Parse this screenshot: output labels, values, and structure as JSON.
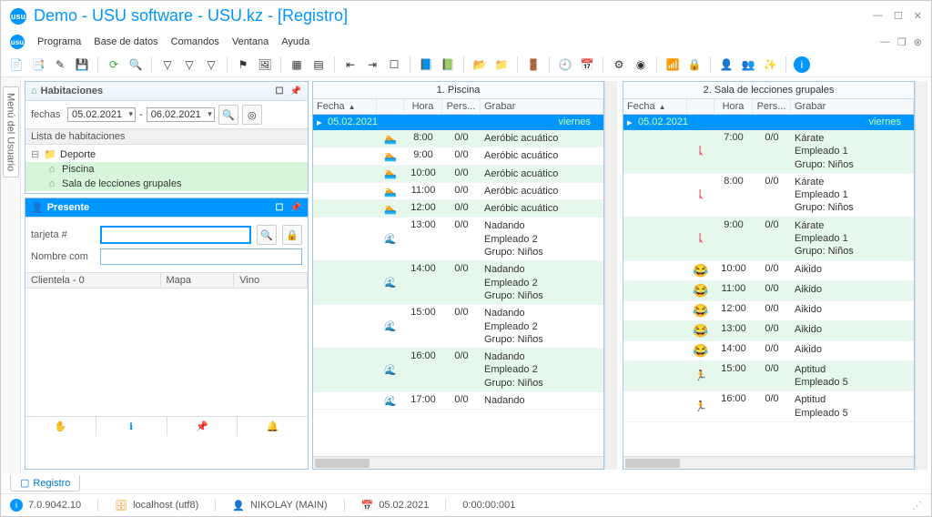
{
  "window": {
    "title": "Demo - USU software - USU.kz - [Registro]"
  },
  "menu": {
    "items": [
      "Programa",
      "Base de datos",
      "Comandos",
      "Ventana",
      "Ayuda"
    ]
  },
  "sidebar_tab": "Menú del Usuario",
  "rooms_panel": {
    "title": "Habitaciones",
    "date_label": "fechas",
    "date_from": "05.02.2021",
    "date_to": "06.02.2021",
    "list_header": "Lista de habitaciones",
    "tree": {
      "root": "Deporte",
      "children": [
        "Piscina",
        "Sala de lecciones grupales"
      ]
    }
  },
  "present_panel": {
    "title": "Presente",
    "card_label": "tarjeta #",
    "name_label": "Nombre com",
    "grid_cols": [
      "Clientela - 0",
      "Mapa",
      "Vino"
    ]
  },
  "schedules": [
    {
      "title": "1. Piscina",
      "cols": [
        "Fecha",
        "Hora",
        "Pers...",
        "Grabar"
      ],
      "date": "05.02.2021",
      "day": "viernes",
      "rows": [
        {
          "icon": "swim",
          "hora": "8:00",
          "pers": "0/0",
          "lines": [
            "Aeróbic acuático"
          ],
          "odd": true
        },
        {
          "icon": "swim",
          "hora": "9:00",
          "pers": "0/0",
          "lines": [
            "Aeróbic acuático"
          ],
          "odd": false
        },
        {
          "icon": "swim",
          "hora": "10:00",
          "pers": "0/0",
          "lines": [
            "Aeróbic acuático"
          ],
          "odd": true
        },
        {
          "icon": "swim",
          "hora": "11:00",
          "pers": "0/0",
          "lines": [
            "Aeróbic acuático"
          ],
          "odd": false
        },
        {
          "icon": "swim",
          "hora": "12:00",
          "pers": "0/0",
          "lines": [
            "Aeróbic acuático"
          ],
          "odd": true
        },
        {
          "icon": "wave",
          "hora": "13:00",
          "pers": "0/0",
          "lines": [
            "Nadando",
            "Empleado 2",
            "Grupo: Niños"
          ],
          "odd": false
        },
        {
          "icon": "wave",
          "hora": "14:00",
          "pers": "0/0",
          "lines": [
            "Nadando",
            "Empleado 2",
            "Grupo: Niños"
          ],
          "odd": true
        },
        {
          "icon": "wave",
          "hora": "15:00",
          "pers": "0/0",
          "lines": [
            "Nadando",
            "Empleado 2",
            "Grupo: Niños"
          ],
          "odd": false
        },
        {
          "icon": "wave",
          "hora": "16:00",
          "pers": "0/0",
          "lines": [
            "Nadando",
            "Empleado 2",
            "Grupo: Niños"
          ],
          "odd": true
        },
        {
          "icon": "wave",
          "hora": "17:00",
          "pers": "0/0",
          "lines": [
            "Nadando"
          ],
          "odd": false
        }
      ]
    },
    {
      "title": "2. Sala de lecciones grupales",
      "cols": [
        "Fecha",
        "Hora",
        "Pers...",
        "Grabar"
      ],
      "date": "05.02.2021",
      "day": "viernes",
      "rows": [
        {
          "icon": "karate",
          "hora": "7:00",
          "pers": "0/0",
          "lines": [
            "Kárate",
            "Empleado 1",
            "Grupo: Niños"
          ],
          "odd": true
        },
        {
          "icon": "karate",
          "hora": "8:00",
          "pers": "0/0",
          "lines": [
            "Kárate",
            "Empleado 1",
            "Grupo: Niños"
          ],
          "odd": false
        },
        {
          "icon": "karate",
          "hora": "9:00",
          "pers": "0/0",
          "lines": [
            "Kárate",
            "Empleado 1",
            "Grupo: Niños"
          ],
          "odd": true
        },
        {
          "icon": "aikido",
          "hora": "10:00",
          "pers": "0/0",
          "lines": [
            "Aikido"
          ],
          "odd": false
        },
        {
          "icon": "aikido",
          "hora": "11:00",
          "pers": "0/0",
          "lines": [
            "Aikido"
          ],
          "odd": true
        },
        {
          "icon": "aikido",
          "hora": "12:00",
          "pers": "0/0",
          "lines": [
            "Aikido"
          ],
          "odd": false
        },
        {
          "icon": "aikido",
          "hora": "13:00",
          "pers": "0/0",
          "lines": [
            "Aikido"
          ],
          "odd": true
        },
        {
          "icon": "aikido",
          "hora": "14:00",
          "pers": "0/0",
          "lines": [
            "Aikido"
          ],
          "odd": false
        },
        {
          "icon": "run",
          "hora": "15:00",
          "pers": "0/0",
          "lines": [
            "Aptitud",
            "Empleado 5"
          ],
          "odd": true
        },
        {
          "icon": "run",
          "hora": "16:00",
          "pers": "0/0",
          "lines": [
            "Aptitud",
            "Empleado 5"
          ],
          "odd": false
        }
      ]
    }
  ],
  "footer_tab": "Registro",
  "status": {
    "version": "7.0.9042.10",
    "host": "localhost (utf8)",
    "user": "NIKOLAY (MAIN)",
    "date": "05.02.2021",
    "time": "0:00:00:001"
  },
  "icons": {
    "swim": "🏊",
    "wave": "🌊",
    "karate": "ᚳ",
    "aikido": "😂",
    "run": "🏃"
  }
}
